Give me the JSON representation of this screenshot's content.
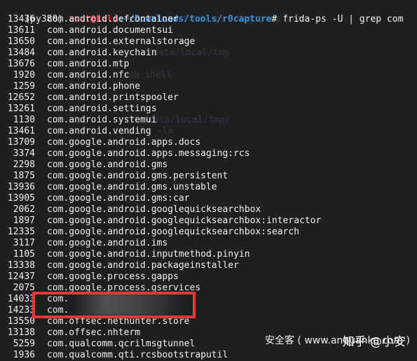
{
  "terminal": {
    "prompt": {
      "env": "(py380)",
      "user_host": "root@kali",
      "separator": ":",
      "path": "~/Downloads/tools/r0capture",
      "symbol": "#",
      "command": "frida-ps -U | grep com"
    },
    "rows": [
      {
        "pid": "13436",
        "name": "com.android.defcontainer"
      },
      {
        "pid": "13611",
        "name": "com.android.documentsui"
      },
      {
        "pid": "13650",
        "name": "com.android.externalstorage"
      },
      {
        "pid": "13484",
        "name": "com.android.keychain"
      },
      {
        "pid": "13676",
        "name": "com.android.mtp"
      },
      {
        "pid": "1920",
        "name": "com.android.nfc"
      },
      {
        "pid": "1259",
        "name": "com.android.phone"
      },
      {
        "pid": "12652",
        "name": "com.android.printspooler"
      },
      {
        "pid": "13261",
        "name": "com.android.settings"
      },
      {
        "pid": "1130",
        "name": "com.android.systemui"
      },
      {
        "pid": "13461",
        "name": "com.android.vending"
      },
      {
        "pid": "13709",
        "name": "com.google.android.apps.docs"
      },
      {
        "pid": "3374",
        "name": "com.google.android.apps.messaging:rcs"
      },
      {
        "pid": "2298",
        "name": "com.google.android.gms"
      },
      {
        "pid": "1875",
        "name": "com.google.android.gms.persistent"
      },
      {
        "pid": "13936",
        "name": "com.google.android.gms.unstable"
      },
      {
        "pid": "13905",
        "name": "com.google.android.gms:car"
      },
      {
        "pid": "2062",
        "name": "com.google.android.googlequicksearchbox"
      },
      {
        "pid": "1897",
        "name": "com.google.android.googlequicksearchbox:interactor"
      },
      {
        "pid": "12335",
        "name": "com.google.android.googlequicksearchbox:search"
      },
      {
        "pid": "3117",
        "name": "com.google.android.ims"
      },
      {
        "pid": "1105",
        "name": "com.google.android.inputmethod.pinyin"
      },
      {
        "pid": "13338",
        "name": "com.google.android.packageinstaller"
      },
      {
        "pid": "12437",
        "name": "com.google.process.gapps"
      },
      {
        "pid": "2075",
        "name": "com.google.process.gservices"
      },
      {
        "pid": "14033",
        "name": "com."
      },
      {
        "pid": "14233",
        "name": "com."
      },
      {
        "pid": "13550",
        "name": "com.offsec.nethunter.store"
      },
      {
        "pid": "13138",
        "name": "com.offsec.nhterm"
      },
      {
        "pid": "5259",
        "name": "com.qualcomm.qcrilmsgtunnel"
      },
      {
        "pid": "1936",
        "name": "com.qualcomm.qti.rcsbootstraputil"
      }
    ],
    "ghost_text": {
      "line1": "frida-ps -U | grep com",
      "line2": "ls",
      "line3": "/data/local/tmp",
      "line4": "adb shell",
      "line5": "cd /data/local/tmp/",
      "line6": "ls -la"
    }
  },
  "watermarks": {
    "zhihu": "知乎 @小安",
    "site": "安全客 ( www.anquanke.com )"
  },
  "colors": {
    "background": "#1e1f21",
    "user_host": "#e0383e",
    "path": "#3d8fd6",
    "highlight_box": "#e5373a"
  }
}
